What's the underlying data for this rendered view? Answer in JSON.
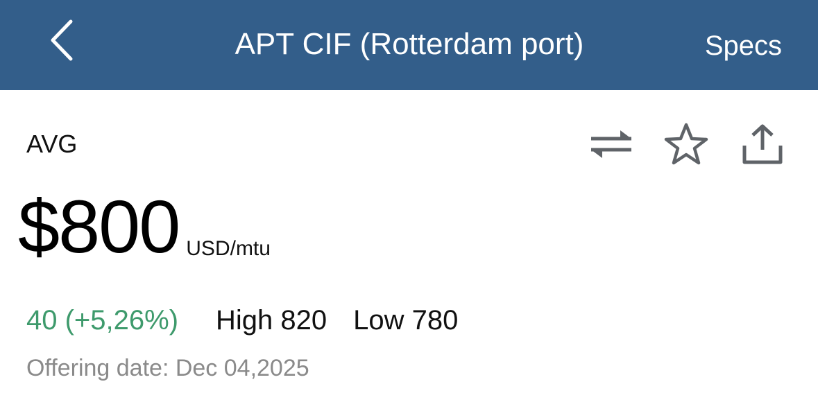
{
  "header": {
    "back_icon": "chevron-left-icon",
    "title": "APT CIF (Rotterdam port)",
    "specs_label": "Specs",
    "background_color": "#335e8a"
  },
  "quote": {
    "label": "AVG",
    "price": "$800",
    "unit": "USD/mtu",
    "change": "40 (+5,26%)",
    "change_color": "#3e9a6c",
    "high": "High 820",
    "low": "Low 780",
    "offering_date": "Offering date: Dec 04,2025"
  },
  "actions": [
    {
      "icon": "swap-icon"
    },
    {
      "icon": "star-icon"
    },
    {
      "icon": "share-icon"
    }
  ]
}
